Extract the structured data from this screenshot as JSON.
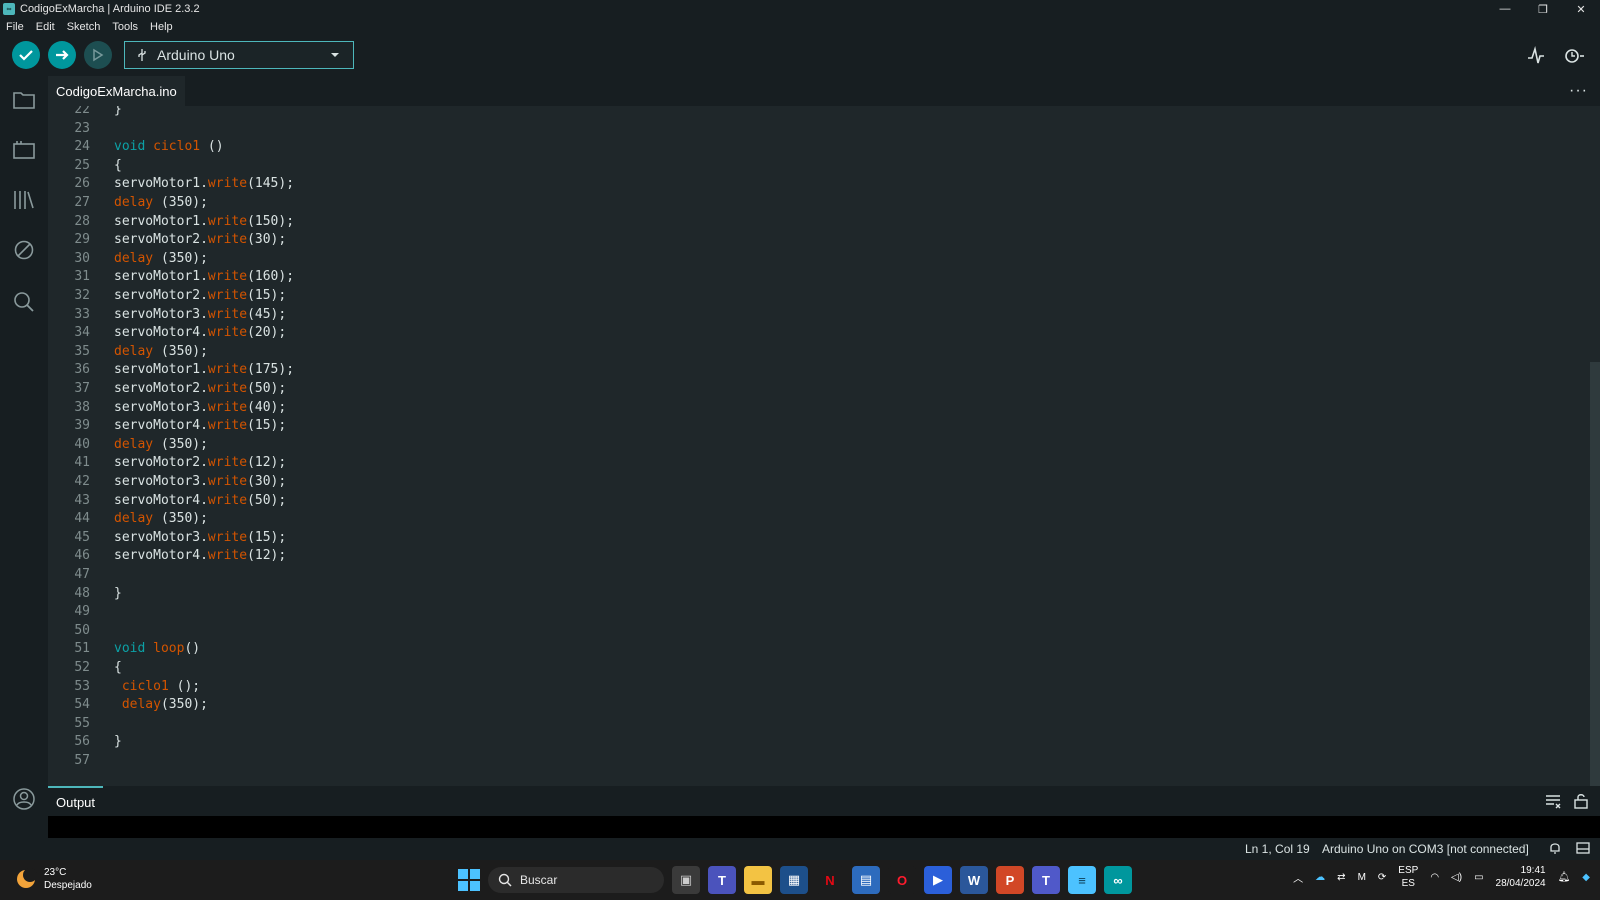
{
  "window": {
    "title": "CodigoExMarcha | Arduino IDE 2.3.2"
  },
  "menu": [
    "File",
    "Edit",
    "Sketch",
    "Tools",
    "Help"
  ],
  "toolbar": {
    "board": "Arduino Uno"
  },
  "tab": {
    "filename": "CodigoExMarcha.ino"
  },
  "code_lines": [
    {
      "n": "22",
      "t": "}"
    },
    {
      "n": "23",
      "t": ""
    },
    {
      "n": "24",
      "t": "void ciclo1 ()"
    },
    {
      "n": "25",
      "t": "{"
    },
    {
      "n": "26",
      "t": "servoMotor1.write(145);"
    },
    {
      "n": "27",
      "t": "delay (350);"
    },
    {
      "n": "28",
      "t": "servoMotor1.write(150);"
    },
    {
      "n": "29",
      "t": "servoMotor2.write(30);"
    },
    {
      "n": "30",
      "t": "delay (350);"
    },
    {
      "n": "31",
      "t": "servoMotor1.write(160);"
    },
    {
      "n": "32",
      "t": "servoMotor2.write(15);"
    },
    {
      "n": "33",
      "t": "servoMotor3.write(45);"
    },
    {
      "n": "34",
      "t": "servoMotor4.write(20);"
    },
    {
      "n": "35",
      "t": "delay (350);"
    },
    {
      "n": "36",
      "t": "servoMotor1.write(175);"
    },
    {
      "n": "37",
      "t": "servoMotor2.write(50);"
    },
    {
      "n": "38",
      "t": "servoMotor3.write(40);"
    },
    {
      "n": "39",
      "t": "servoMotor4.write(15);"
    },
    {
      "n": "40",
      "t": "delay (350);"
    },
    {
      "n": "41",
      "t": "servoMotor2.write(12);"
    },
    {
      "n": "42",
      "t": "servoMotor3.write(30);"
    },
    {
      "n": "43",
      "t": "servoMotor4.write(50);"
    },
    {
      "n": "44",
      "t": "delay (350);"
    },
    {
      "n": "45",
      "t": "servoMotor3.write(15);"
    },
    {
      "n": "46",
      "t": "servoMotor4.write(12);"
    },
    {
      "n": "47",
      "t": ""
    },
    {
      "n": "48",
      "t": "}"
    },
    {
      "n": "49",
      "t": ""
    },
    {
      "n": "50",
      "t": ""
    },
    {
      "n": "51",
      "t": "void loop()"
    },
    {
      "n": "52",
      "t": "{"
    },
    {
      "n": "53",
      "t": " ciclo1 ();"
    },
    {
      "n": "54",
      "t": " delay(350);"
    },
    {
      "n": "55",
      "t": ""
    },
    {
      "n": "56",
      "t": "}"
    },
    {
      "n": "57",
      "t": ""
    }
  ],
  "output": {
    "label": "Output"
  },
  "status": {
    "position": "Ln 1, Col 19",
    "board": "Arduino Uno on COM3 [not connected]"
  },
  "taskbar": {
    "weather_temp": "23°C",
    "weather_desc": "Despejado",
    "search": "Buscar",
    "lang_top": "ESP",
    "lang_bottom": "ES",
    "time": "19:41",
    "date": "28/04/2024"
  },
  "colors": {
    "accent": "#00979d",
    "editor_bg": "#1f272a",
    "keyword": "#0ca1a6",
    "function": "#d35400"
  }
}
